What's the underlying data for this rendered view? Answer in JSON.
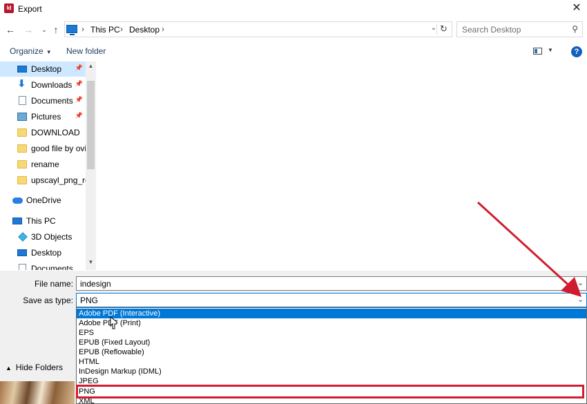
{
  "window": {
    "title": "Export",
    "app_icon_text": "Id"
  },
  "address_bar": {
    "crumbs": [
      "This PC",
      "Desktop"
    ]
  },
  "search": {
    "placeholder": "Search Desktop"
  },
  "toolbar": {
    "organize_label": "Organize",
    "new_folder_label": "New folder"
  },
  "nav_pane": {
    "quick_access": [
      {
        "label": "Desktop",
        "icon": "desktop-icon",
        "pinned": true,
        "selected": true
      },
      {
        "label": "Downloads",
        "icon": "download-arrow-icon",
        "pinned": true
      },
      {
        "label": "Documents",
        "icon": "document-icon",
        "pinned": true
      },
      {
        "label": "Pictures",
        "icon": "pictures-icon",
        "pinned": true
      },
      {
        "label": "DOWNLOAD",
        "icon": "folder-icon"
      },
      {
        "label": "good file by ovi",
        "icon": "folder-icon"
      },
      {
        "label": "rename",
        "icon": "folder-icon"
      },
      {
        "label": "upscayl_png_rea",
        "icon": "folder-icon"
      }
    ],
    "onedrive": {
      "label": "OneDrive",
      "icon": "cloud-icon"
    },
    "this_pc": {
      "label": "This PC",
      "icon": "pc-icon",
      "children": [
        {
          "label": "3D Objects",
          "icon": "3d-objects-icon"
        },
        {
          "label": "Desktop",
          "icon": "desktop-icon"
        },
        {
          "label": "Documents",
          "icon": "document-icon"
        }
      ]
    }
  },
  "form": {
    "file_name_label": "File name:",
    "file_name_value": "indesign",
    "save_as_type_label": "Save as type:",
    "save_as_type_value": "PNG"
  },
  "type_options": [
    "Adobe PDF (Interactive)",
    "Adobe PDF (Print)",
    "EPS",
    "EPUB (Fixed Layout)",
    "EPUB (Reflowable)",
    "HTML",
    "InDesign Markup (IDML)",
    "JPEG",
    "PNG",
    "XML"
  ],
  "highlighted_option": "Adobe PDF (Interactive)",
  "annotated_option": "PNG",
  "hide_folders_label": "Hide Folders",
  "colors": {
    "accent": "#0078d7",
    "annotation_red": "#d11c2f",
    "selected_nav": "#cde8ff"
  }
}
